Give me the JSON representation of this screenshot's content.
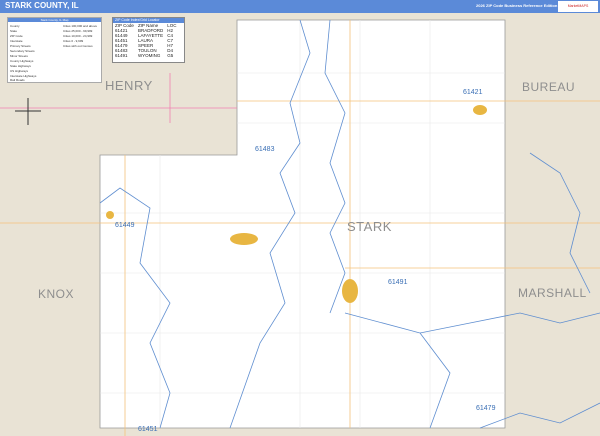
{
  "header": {
    "title": "STARK COUNTY, IL",
    "edition": "2026 ZIP Code Business Reference Edition",
    "logo": "Market MAPS"
  },
  "legend": {
    "title": "Stark County, IL Map",
    "items": [
      "County",
      "State",
      "ZIP Code",
      "Interstate",
      "Primary Streets",
      "Secondary Streets",
      "Minor Streets",
      "County Highways",
      "State Highways",
      "US Highways",
      "Interstate Highways",
      "Rail Roads"
    ],
    "cities": [
      "Cities 100,000 and above",
      "Cities 25,000 - 99,999",
      "Cities 10,000 - 24,999",
      "Cities 0 - 9,999",
      "Cities with out Census"
    ]
  },
  "zip_index": {
    "title": "ZIP Code Index/Grid Locator",
    "headers": [
      "ZIP Code",
      "ZIP Name",
      "LOC"
    ],
    "rows": [
      [
        "61421",
        "BRADFORD",
        "H2"
      ],
      [
        "61449",
        "LAFAYETTE",
        "C4"
      ],
      [
        "61451",
        "LAURA",
        "C7"
      ],
      [
        "61479",
        "SPEER",
        "H7"
      ],
      [
        "61483",
        "TOULON",
        "D4"
      ],
      [
        "61491",
        "WYOMING",
        "G5"
      ]
    ]
  },
  "counties": {
    "henry": "HENRY",
    "bureau": "BUREAU",
    "knox": "KNOX",
    "marshall": "MARSHALL",
    "stark": "STARK"
  },
  "zips": {
    "z1": "61421",
    "z2": "61483",
    "z3": "61449",
    "z4": "61491",
    "z5": "61479",
    "z6": "61451"
  }
}
